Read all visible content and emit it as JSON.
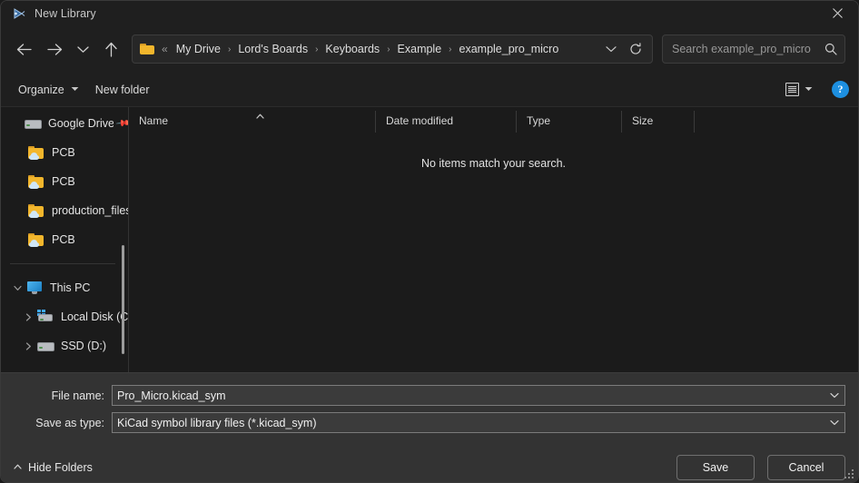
{
  "window": {
    "title": "New Library",
    "title_icon": "kicad-symbol-editor-icon",
    "close_label": "close-icon"
  },
  "nav": {
    "back": "back-arrow-icon",
    "forward": "forward-arrow-icon",
    "recent": "chevron-down-icon",
    "up": "up-arrow-icon",
    "refresh": "refresh-icon",
    "address_chevron": "chevron-down-icon"
  },
  "breadcrumb": {
    "folder_icon": "folder-icon",
    "overflow": "«",
    "separator": "›",
    "items": [
      {
        "label": "My Drive"
      },
      {
        "label": "Lord's Boards"
      },
      {
        "label": "Keyboards"
      },
      {
        "label": "Example"
      },
      {
        "label": "example_pro_micro"
      }
    ]
  },
  "search": {
    "placeholder": "Search example_pro_micro",
    "value": "",
    "icon": "search-icon"
  },
  "commandbar": {
    "organize": "Organize",
    "new_folder": "New folder",
    "view_icon": "details-view-icon",
    "view_caret": "chevron-down-icon",
    "help": "?"
  },
  "sidebar": {
    "items": [
      {
        "label": "Google Drive",
        "icon": "drive-icon",
        "pinned": true,
        "expander": false,
        "indent": 0
      },
      {
        "label": "PCB",
        "icon": "folder-cloud-icon",
        "pinned": false,
        "expander": false,
        "indent": 1
      },
      {
        "label": "PCB",
        "icon": "folder-cloud-icon",
        "pinned": false,
        "expander": false,
        "indent": 1
      },
      {
        "label": "production_files",
        "icon": "folder-cloud-icon",
        "pinned": false,
        "expander": false,
        "indent": 1
      },
      {
        "label": "PCB",
        "icon": "folder-cloud-icon",
        "pinned": false,
        "expander": false,
        "indent": 1
      }
    ],
    "items2": [
      {
        "label": "This PC",
        "icon": "this-pc-icon",
        "expander": "expanded",
        "indent": 0
      },
      {
        "label": "Local Disk (C:)",
        "icon": "windows-disk-icon",
        "expander": "collapsed",
        "indent": 1
      },
      {
        "label": "SSD (D:)",
        "icon": "disk-icon",
        "expander": "collapsed",
        "indent": 1
      }
    ]
  },
  "filelist": {
    "columns": [
      {
        "label": "Name",
        "sorted": "asc"
      },
      {
        "label": "Date modified",
        "sorted": ""
      },
      {
        "label": "Type",
        "sorted": ""
      },
      {
        "label": "Size",
        "sorted": ""
      }
    ],
    "empty_message": "No items match your search.",
    "rows": []
  },
  "form": {
    "filename_label": "File name:",
    "filename_value": "Pro_Micro.kicad_sym",
    "filetype_label": "Save as type:",
    "filetype_value": "KiCad symbol library files (*.kicad_sym)",
    "dropdown_icon": "chevron-down-icon"
  },
  "footer": {
    "hide_folders": "Hide Folders",
    "hide_folders_caret": "chevron-up-icon",
    "save": "Save",
    "cancel": "Cancel",
    "resize_grip": "resize-grip-icon"
  },
  "colors": {
    "window_bg": "#202020",
    "pane_bg": "#1b1b1b",
    "bottom_bg": "#333333",
    "accent_blue": "#1d8fe0",
    "folder_yellow": "#f2b62c",
    "text": "#e4e4e4"
  }
}
